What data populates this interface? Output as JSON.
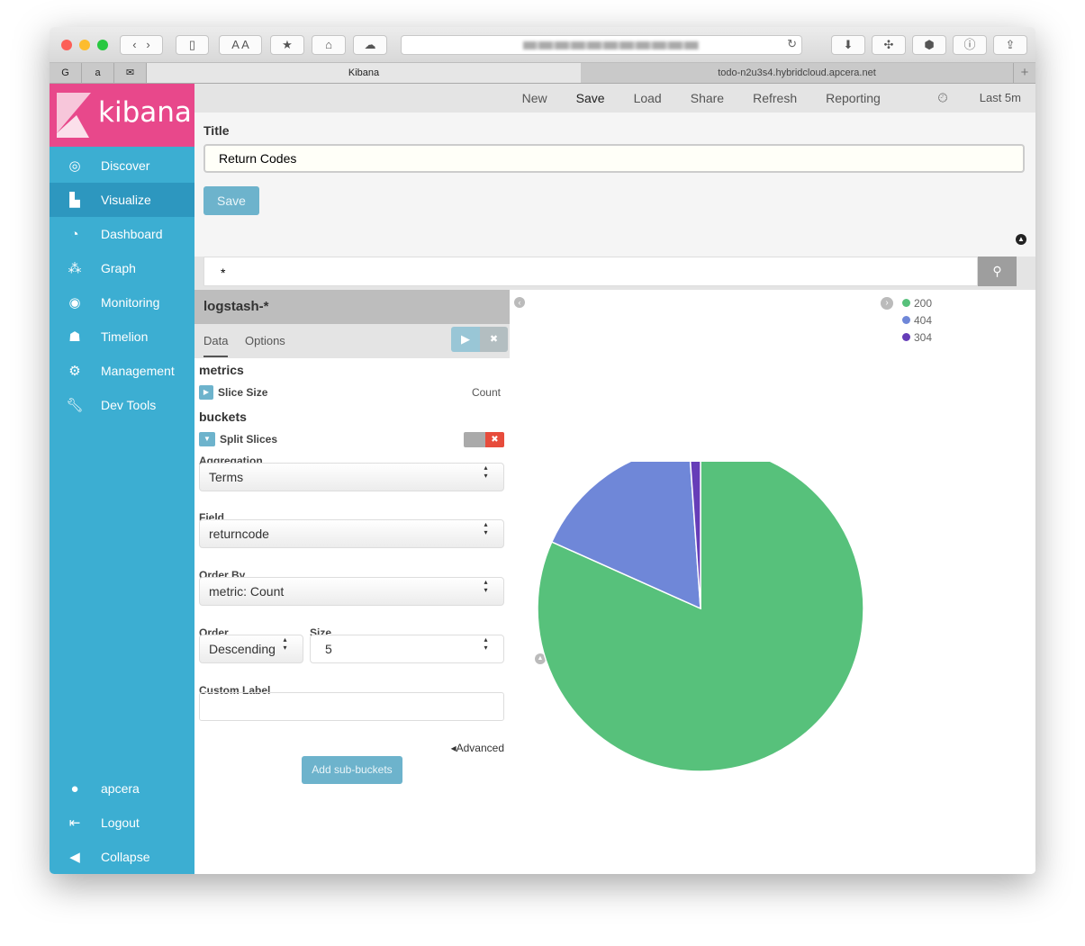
{
  "browser": {
    "tabs": [
      "Kibana",
      "todo-n2u3s4.hybridcloud.apcera.net"
    ],
    "favorites": [
      "G",
      "a",
      "✉"
    ],
    "new_tab": "+"
  },
  "sidebar": {
    "brand": "kibana",
    "items": [
      {
        "label": "Discover",
        "icon": "compass-icon"
      },
      {
        "label": "Visualize",
        "icon": "bar-chart-icon"
      },
      {
        "label": "Dashboard",
        "icon": "dashboard-icon"
      },
      {
        "label": "Graph",
        "icon": "graph-icon"
      },
      {
        "label": "Monitoring",
        "icon": "eye-icon"
      },
      {
        "label": "Timelion",
        "icon": "timelion-icon"
      },
      {
        "label": "Management",
        "icon": "gear-icon"
      },
      {
        "label": "Dev Tools",
        "icon": "wrench-icon"
      }
    ],
    "bottom": [
      {
        "label": "apcera",
        "icon": "user-icon"
      },
      {
        "label": "Logout",
        "icon": "logout-icon"
      },
      {
        "label": "Collapse",
        "icon": "collapse-icon"
      }
    ]
  },
  "topnav": {
    "items": [
      "New",
      "Save",
      "Load",
      "Share",
      "Refresh",
      "Reporting"
    ],
    "time": "Last 5m"
  },
  "save": {
    "title_label": "Title",
    "title_value": "Return Codes",
    "save_button": "Save"
  },
  "query": {
    "value": "*"
  },
  "editor": {
    "index": "logstash-*",
    "tabs": [
      "Data",
      "Options"
    ],
    "metrics_heading": "metrics",
    "metric_label": "Slice Size",
    "metric_value": "Count",
    "buckets_heading": "buckets",
    "bucket_label": "Split Slices",
    "aggregation_label": "Aggregation",
    "aggregation": "Terms",
    "field_label": "Field",
    "field": "returncode",
    "orderby_label": "Order By",
    "orderby": "metric: Count",
    "order_label": "Order",
    "order": "Descending",
    "size_label": "Size",
    "size": "5",
    "custom_label": "Custom Label",
    "custom_value": "",
    "advanced": "Advanced",
    "add_sub": "Add sub-buckets"
  },
  "chart_data": {
    "type": "pie",
    "categories": [
      "200",
      "404",
      "304"
    ],
    "values_percent": [
      81.7,
      17.2,
      1.1
    ],
    "colors": [
      "#57c17b",
      "#6f87d8",
      "#663db8"
    ],
    "legend": "top-right"
  }
}
